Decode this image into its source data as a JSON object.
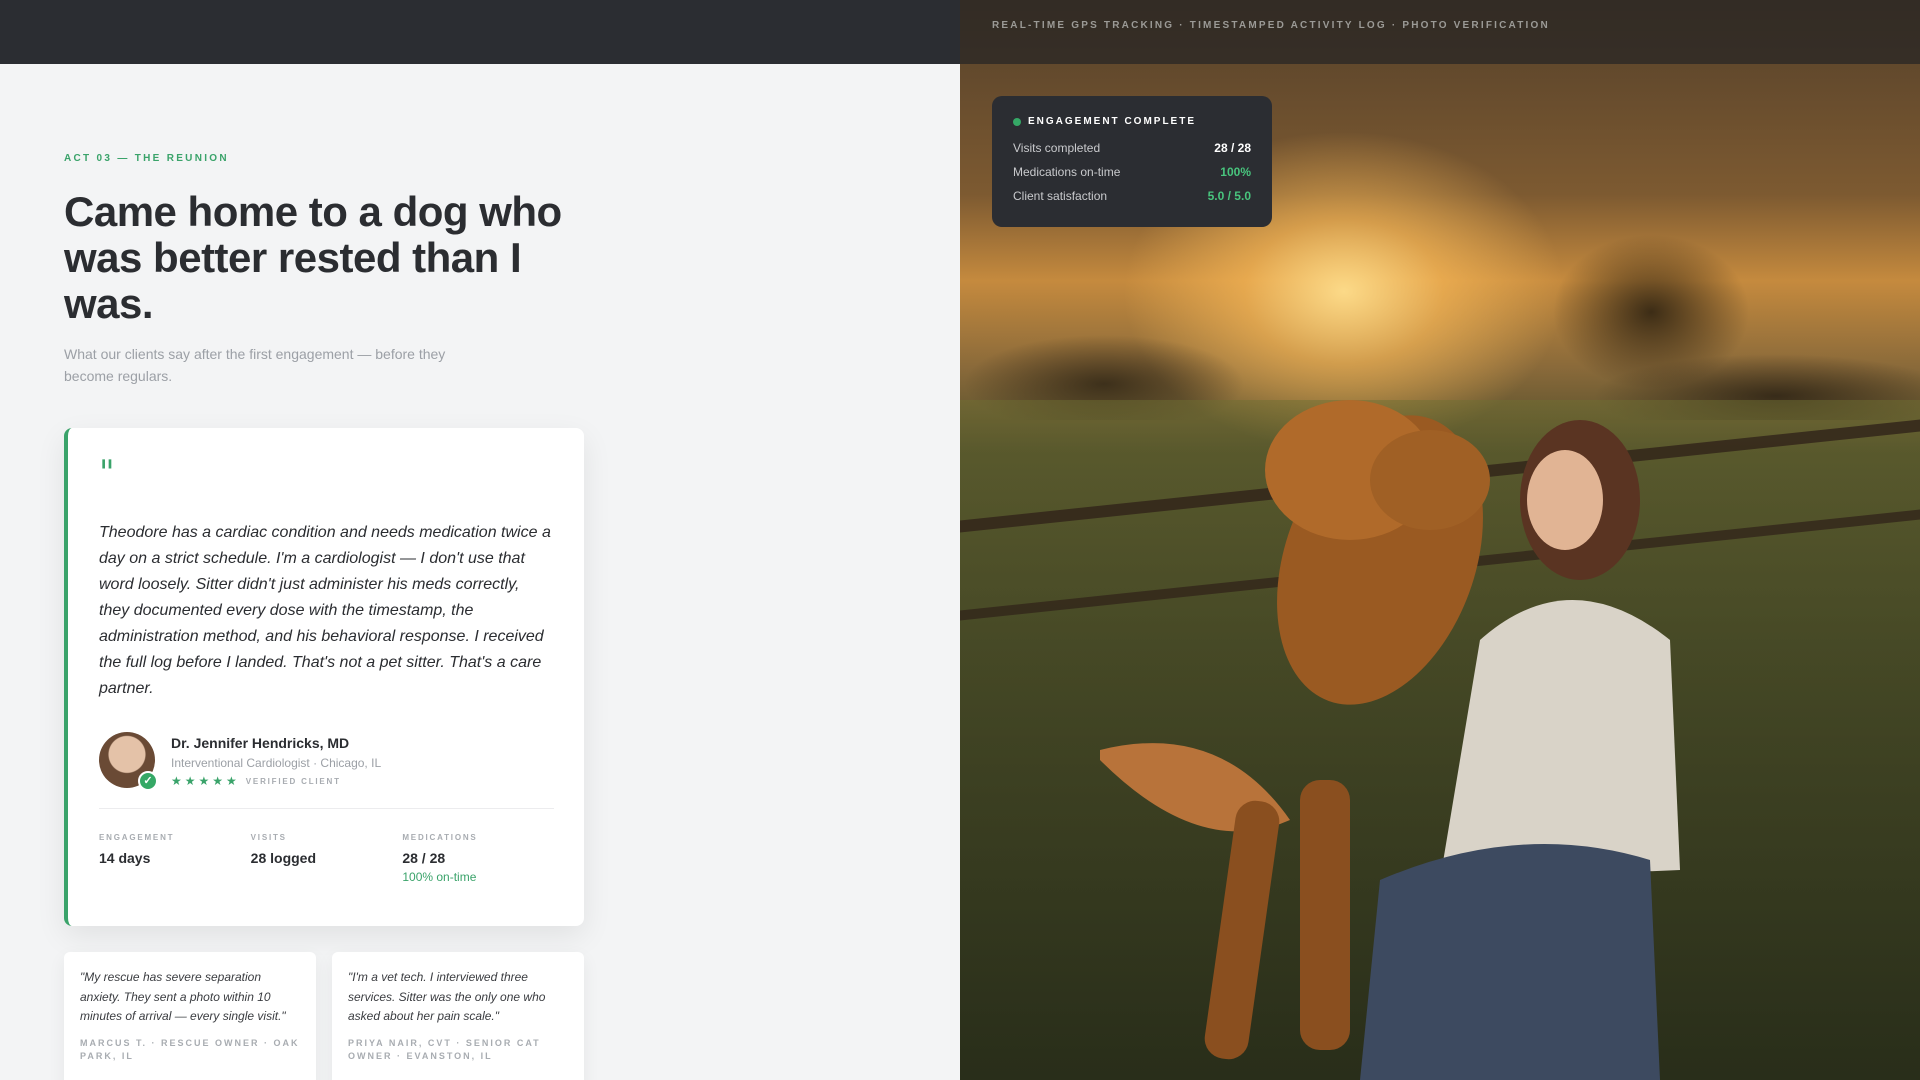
{
  "topbar": {
    "caption": "REAL-TIME GPS TRACKING · TIMESTAMPED ACTIVITY LOG · PHOTO VERIFICATION"
  },
  "stats_card": {
    "title": "ENGAGEMENT COMPLETE",
    "rows": [
      {
        "label": "Visits completed",
        "value": "28 / 28"
      },
      {
        "label": "Medications on-time",
        "value": "100%"
      },
      {
        "label": "Client satisfaction",
        "value": "5.0 / 5.0"
      }
    ]
  },
  "hero": {
    "act": "ACT 03 — THE REUNION",
    "headline": "Came home to a dog who was better rested than I was.",
    "subtitle": "What our clients say after the first engagement — before they become regulars."
  },
  "testimonial": {
    "quote_mark": "\"",
    "quote": "Theodore has a cardiac condition and needs medication twice a day on a strict schedule. I'm a cardiologist — I don't use that word loosely. Sitter didn't just administer his meds correctly, they documented every dose with the timestamp, the administration method, and his behavioral response. I received the full log before I landed. That's not a pet sitter. That's a care partner.",
    "author": "Dr. Jennifer Hendricks, MD",
    "role": "Interventional Cardiologist · Chicago, IL",
    "stars": "★★★★★",
    "rating": 5,
    "verified": "VERIFIED CLIENT",
    "metrics": [
      {
        "label": "ENGAGEMENT",
        "value": "14 days",
        "sub": ""
      },
      {
        "label": "VISITS",
        "value": "28 logged",
        "sub": ""
      },
      {
        "label": "MEDICATIONS",
        "value": "28 / 28",
        "sub": "100% on-time"
      }
    ]
  },
  "mini_testimonials": [
    {
      "quote": "\"My rescue has severe separation anxiety. They sent a photo within 10 minutes of arrival — every single visit.\"",
      "attribution": "MARCUS T. · RESCUE OWNER · OAK PARK, IL"
    },
    {
      "quote": "\"I'm a vet tech. I interviewed three services. Sitter was the only one who asked about her pain scale.\"",
      "attribution": "PRIYA NAIR, CVT · SENIOR CAT OWNER · EVANSTON, IL"
    }
  ],
  "colors": {
    "accent": "#3aa36a",
    "dark": "#2b2d32"
  }
}
